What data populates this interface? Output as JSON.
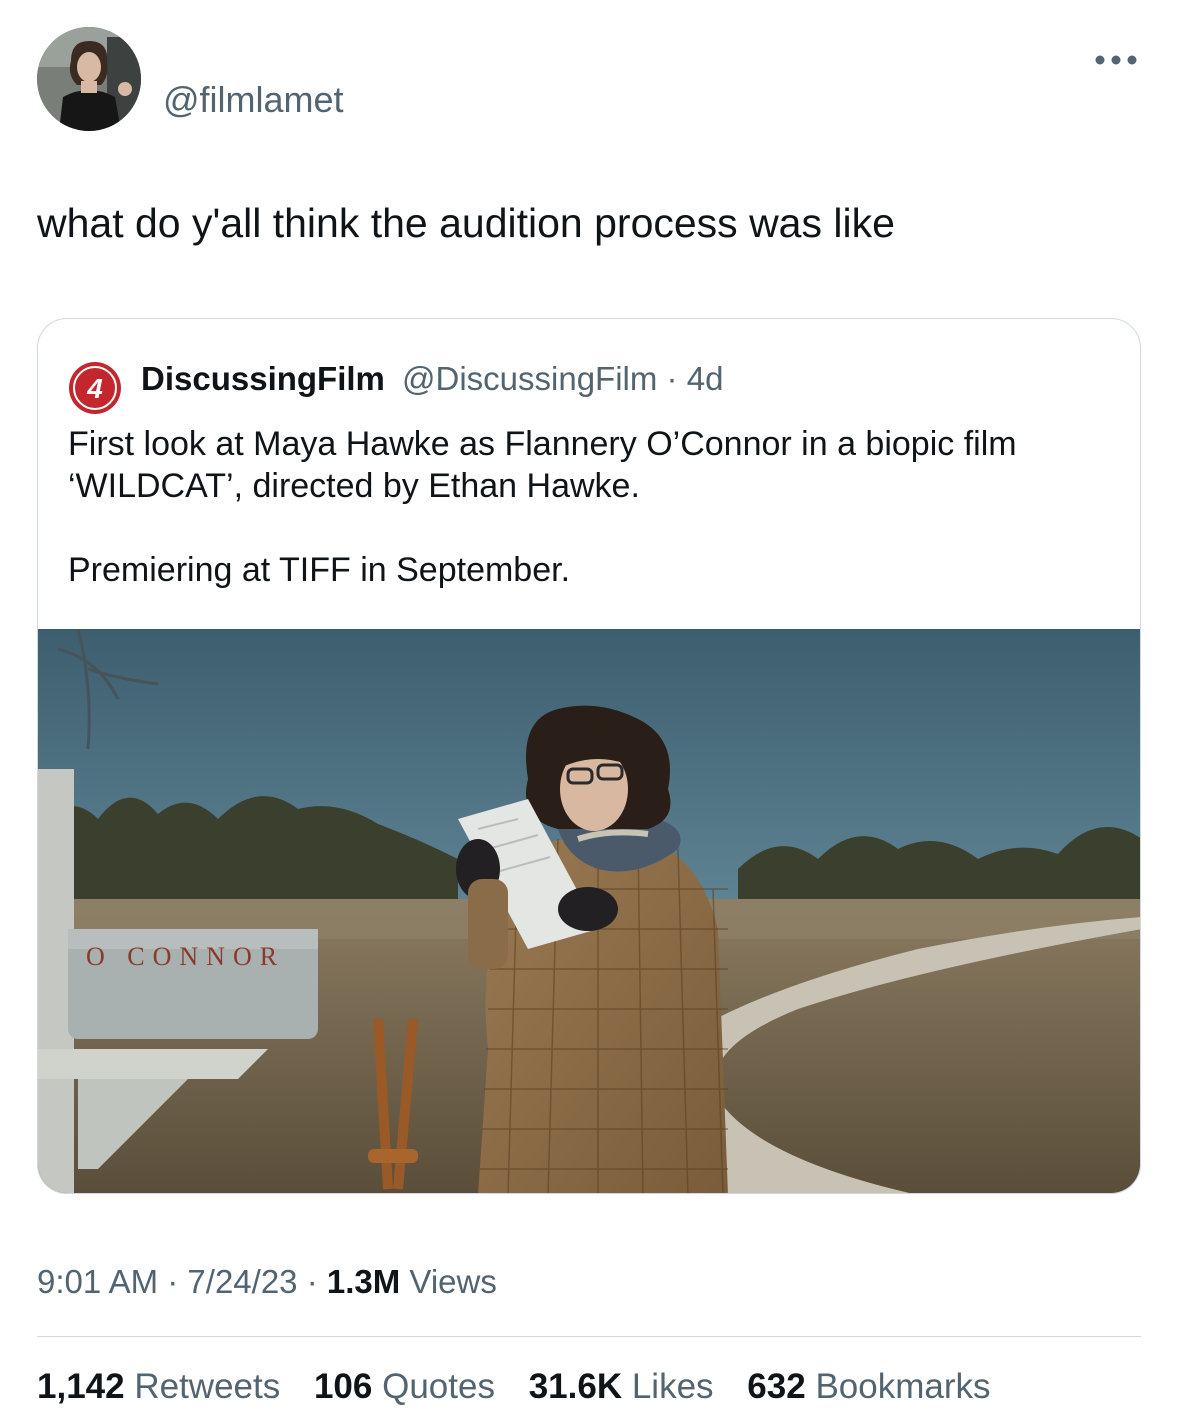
{
  "author": {
    "handle": "@filmlamet"
  },
  "tweet": {
    "text": "what do y'all think the audition process was like",
    "time": "9:01 AM",
    "date": "7/24/23",
    "views_count": "1.3M",
    "views_label": "Views",
    "separator": "·"
  },
  "quoted": {
    "name": "DiscussingFilm",
    "handle": "@DiscussingFilm",
    "separator": "·",
    "age": "4d",
    "logo_text": "4",
    "text_p1": "First look at Maya Hawke as Flannery O’Connor in a biopic film ‘WILDCAT’, directed by Ethan Hawke.",
    "text_p2": "Premiering at TIFF in September.",
    "mailbox_text": "O CONNOR"
  },
  "stats": [
    {
      "count": "1,142",
      "label": "Retweets"
    },
    {
      "count": "106",
      "label": "Quotes"
    },
    {
      "count": "31.6K",
      "label": "Likes"
    },
    {
      "count": "632",
      "label": "Bookmarks"
    }
  ],
  "colors": {
    "text": "#0f1419",
    "secondary": "#536471",
    "border": "#cfd9de",
    "logo_red": "#c4262e"
  },
  "icons": {
    "more": "more-dots-icon"
  }
}
